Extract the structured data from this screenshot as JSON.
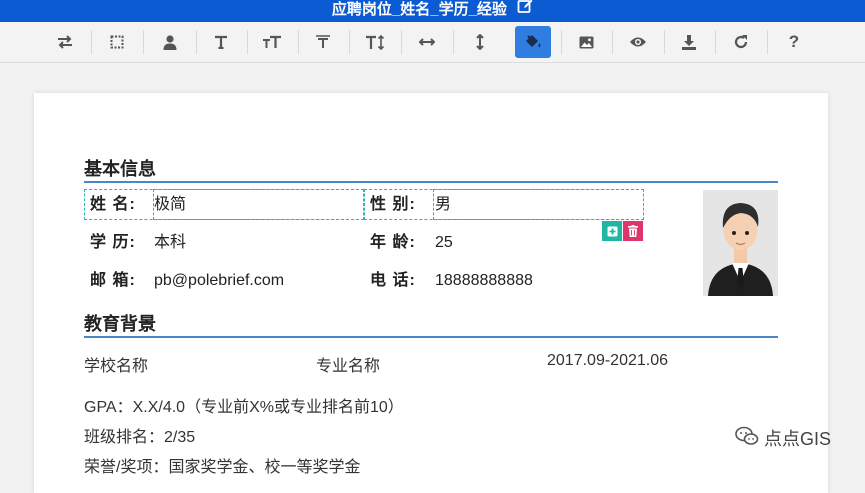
{
  "header": {
    "title": "应聘岗位_姓名_学历_经验"
  },
  "toolbar": {
    "buttons": [
      {
        "name": "swap-icon"
      },
      {
        "name": "crop-icon"
      },
      {
        "name": "user-icon"
      },
      {
        "name": "text-icon"
      },
      {
        "name": "font-size-icon"
      },
      {
        "name": "text-spacing-icon"
      },
      {
        "name": "line-height-icon"
      },
      {
        "name": "horizontal-resize-icon"
      },
      {
        "name": "vertical-resize-icon"
      },
      {
        "name": "paint-bucket-icon",
        "active": true
      },
      {
        "name": "image-icon"
      },
      {
        "name": "eye-icon"
      },
      {
        "name": "download-icon"
      },
      {
        "name": "redo-icon"
      },
      {
        "name": "help-icon"
      }
    ],
    "colors": {
      "active_bg": "#2f7de1",
      "icon": "#555555"
    }
  },
  "resume": {
    "basic_title": "基本信息",
    "name_label": "姓 名:",
    "name_value": "极简",
    "gender_label": "性 别:",
    "gender_value": "男",
    "education_label": "学 历:",
    "education_value": "本科",
    "age_label": "年 龄:",
    "age_value": "25",
    "email_label": "邮 箱:",
    "email_value": "pb@polebrief.com",
    "phone_label": "电 话:",
    "phone_value": "18888888888",
    "edu_title": "教育背景",
    "school": "学校名称",
    "major": "专业名称",
    "period": "2017.09-2021.06",
    "gpa": "GPA：X.X/4.0（专业前X%或专业排名前10）",
    "rank": "班级排名：2/35",
    "honors": "荣誉/奖项：国家奖学金、校一等奖学金"
  },
  "watermark": "点点GIS",
  "colors": {
    "title_bar": "#0b5bd3",
    "section_rule": "#4a86c8",
    "dashed_outline": "#28b8b0",
    "add_btn": "#1fb6a5",
    "delete_btn": "#e0356a"
  }
}
